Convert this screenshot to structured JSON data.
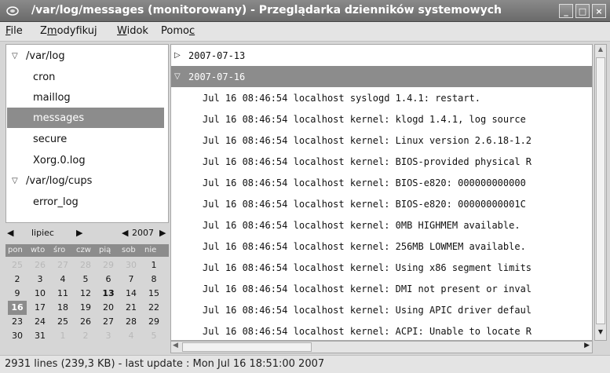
{
  "window": {
    "title": "/var/log/messages (monitorowany) - Przeglądarka dzienników systemowych",
    "buttons": {
      "minimize": "_",
      "maximize": "□",
      "close": "×"
    }
  },
  "menu": [
    {
      "pre": "",
      "u": "F",
      "post": "ile"
    },
    {
      "pre": "Z",
      "u": "m",
      "post": "odyfikuj"
    },
    {
      "pre": "",
      "u": "W",
      "post": "idok"
    },
    {
      "pre": "Pomo",
      "u": "c",
      "post": ""
    }
  ],
  "tree": [
    {
      "label": "/var/log",
      "expanded": true,
      "level": 0,
      "selected": false
    },
    {
      "label": "cron",
      "level": 1,
      "selected": false
    },
    {
      "label": "maillog",
      "level": 1,
      "selected": false
    },
    {
      "label": "messages",
      "level": 1,
      "selected": true
    },
    {
      "label": "secure",
      "level": 1,
      "selected": false
    },
    {
      "label": "Xorg.0.log",
      "level": 1,
      "selected": false
    },
    {
      "label": "/var/log/cups",
      "expanded": true,
      "level": 0,
      "selected": false
    },
    {
      "label": "error_log",
      "level": 1,
      "selected": false
    }
  ],
  "calendar": {
    "month": "lipiec",
    "year": "2007",
    "weekdays": [
      "pon",
      "wto",
      "śro",
      "czw",
      "pią",
      "sob",
      "nie"
    ],
    "weeks": [
      [
        {
          "d": "25",
          "o": 1
        },
        {
          "d": "26",
          "o": 1
        },
        {
          "d": "27",
          "o": 1
        },
        {
          "d": "28",
          "o": 1
        },
        {
          "d": "29",
          "o": 1
        },
        {
          "d": "30",
          "o": 1
        },
        {
          "d": "1"
        }
      ],
      [
        {
          "d": "2"
        },
        {
          "d": "3"
        },
        {
          "d": "4"
        },
        {
          "d": "5"
        },
        {
          "d": "6"
        },
        {
          "d": "7"
        },
        {
          "d": "8"
        }
      ],
      [
        {
          "d": "9"
        },
        {
          "d": "10"
        },
        {
          "d": "11"
        },
        {
          "d": "12"
        },
        {
          "d": "13",
          "b": 1
        },
        {
          "d": "14"
        },
        {
          "d": "15"
        }
      ],
      [
        {
          "d": "16",
          "s": 1
        },
        {
          "d": "17"
        },
        {
          "d": "18"
        },
        {
          "d": "19"
        },
        {
          "d": "20"
        },
        {
          "d": "21"
        },
        {
          "d": "22"
        }
      ],
      [
        {
          "d": "23"
        },
        {
          "d": "24"
        },
        {
          "d": "25"
        },
        {
          "d": "26"
        },
        {
          "d": "27"
        },
        {
          "d": "28"
        },
        {
          "d": "29"
        }
      ],
      [
        {
          "d": "30"
        },
        {
          "d": "31"
        },
        {
          "d": "1",
          "o": 1
        },
        {
          "d": "2",
          "o": 1
        },
        {
          "d": "3",
          "o": 1
        },
        {
          "d": "4",
          "o": 1
        },
        {
          "d": "5",
          "o": 1
        }
      ]
    ]
  },
  "log": {
    "groups": [
      {
        "label": "2007-07-13",
        "expanded": false,
        "selected": false
      },
      {
        "label": "2007-07-16",
        "expanded": true,
        "selected": true
      }
    ],
    "lines": [
      "Jul 16 08:46:54 localhost syslogd 1.4.1: restart.",
      "Jul 16 08:46:54 localhost kernel: klogd 1.4.1, log source",
      "Jul 16 08:46:54 localhost kernel: Linux version 2.6.18-1.2",
      "Jul 16 08:46:54 localhost kernel: BIOS-provided physical R",
      "Jul 16 08:46:54 localhost kernel:  BIOS-e820: 000000000000",
      "Jul 16 08:46:54 localhost kernel:  BIOS-e820: 00000000001C",
      "Jul 16 08:46:54 localhost kernel: 0MB HIGHMEM available.",
      "Jul 16 08:46:54 localhost kernel: 256MB LOWMEM available.",
      "Jul 16 08:46:54 localhost kernel: Using x86 segment limits",
      "Jul 16 08:46:54 localhost kernel: DMI not present or inval",
      "Jul 16 08:46:54 localhost kernel: Using APIC driver defaul",
      "Jul 16 08:46:54 localhost kernel: ACPI: Unable to locate R"
    ]
  },
  "status": "2931 lines (239,3 KB) - last update : Mon Jul 16 18:51:00 2007",
  "colors": {
    "selection": "#8c8c8c",
    "titlebar": "#7a7a7a"
  }
}
